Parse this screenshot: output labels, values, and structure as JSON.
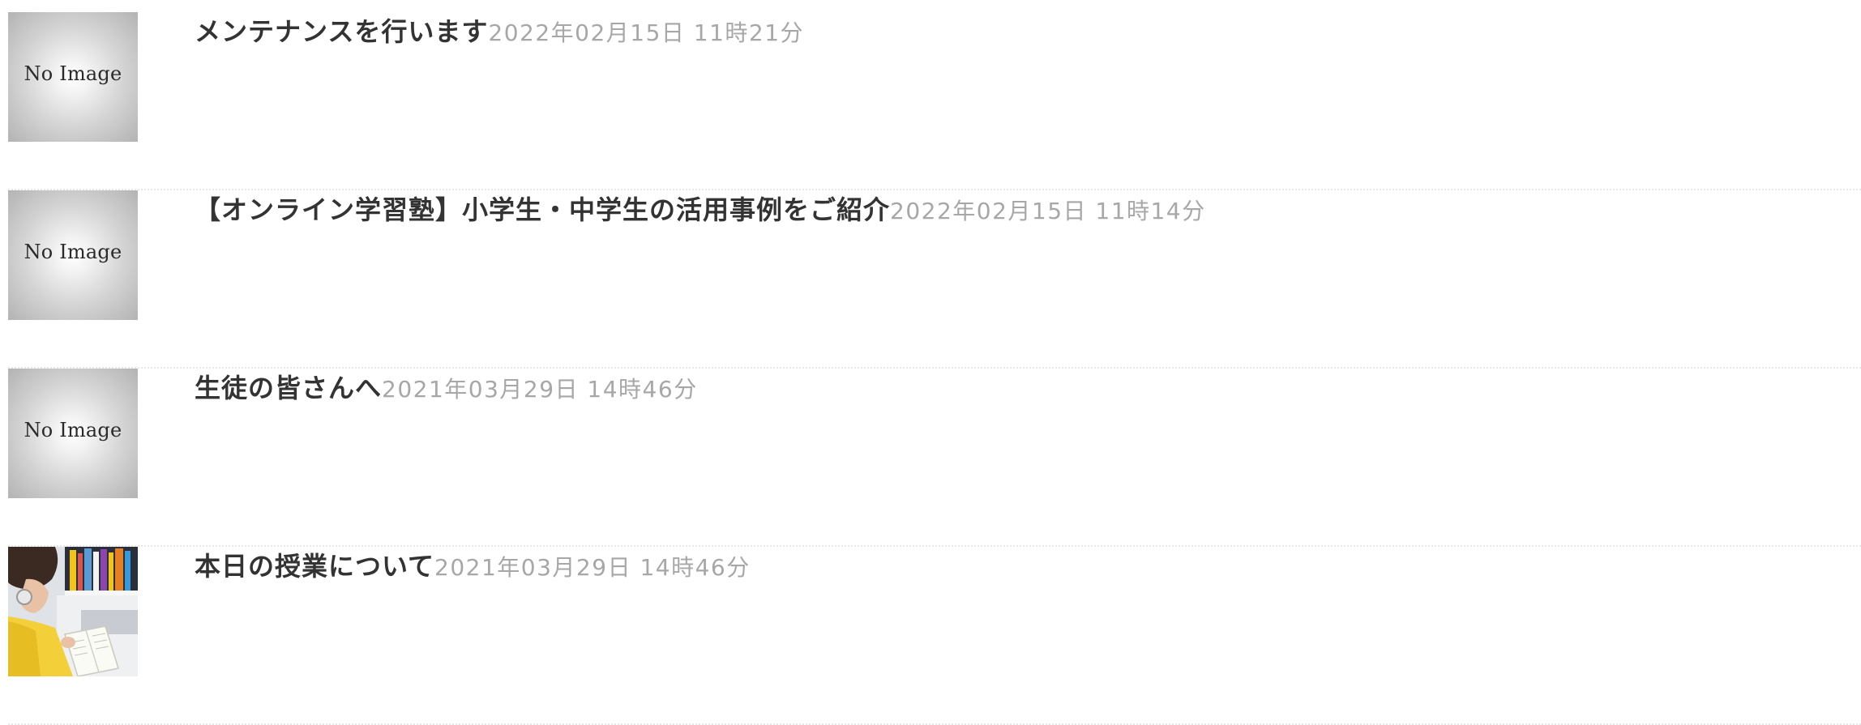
{
  "posts": [
    {
      "title": "メンテナンスを行います",
      "date": "2022年02月15日 11時21分",
      "thumbnail": {
        "type": "no-image",
        "text": "No Image"
      }
    },
    {
      "title": "【オンライン学習塾】小学生・中学生の活用事例をご紹介",
      "date": "2022年02月15日 11時14分",
      "thumbnail": {
        "type": "no-image",
        "text": "No Image"
      }
    },
    {
      "title": "生徒の皆さんへ",
      "date": "2021年03月29日 14時46分",
      "thumbnail": {
        "type": "no-image",
        "text": "No Image"
      }
    },
    {
      "title": "本日の授業について",
      "date": "2021年03月29日 14時46分",
      "thumbnail": {
        "type": "photo"
      }
    }
  ],
  "colors": {
    "title": "#333333",
    "date": "#a7a7a7",
    "divider": "#e6e6e6",
    "noimage_center": "#ffffff",
    "noimage_edge": "#b3b3b3"
  }
}
